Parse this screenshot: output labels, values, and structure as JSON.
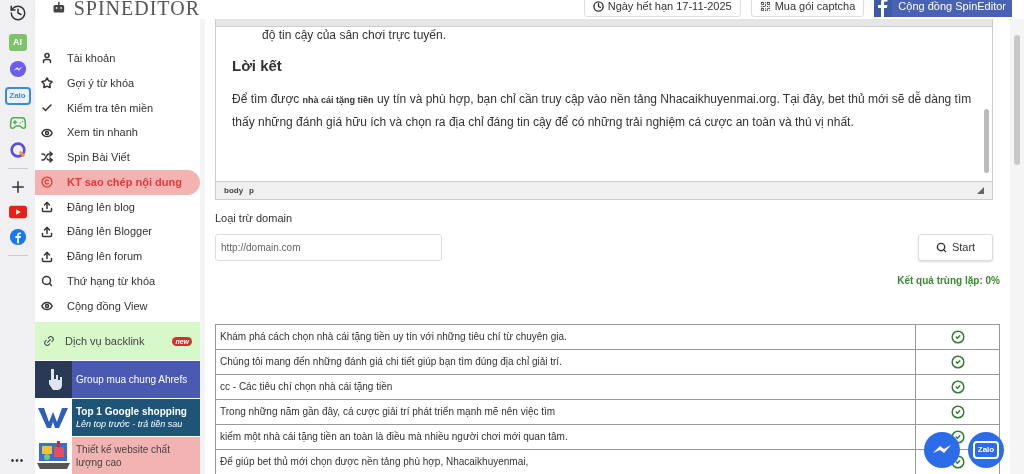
{
  "rail": {
    "ai_badge": "AI",
    "zalo_badge": "Zalo",
    "more": "•••"
  },
  "header": {
    "logo": "SPINEDITOR",
    "buttons": [
      {
        "kind": "expiry",
        "label": "Ngày hết hạn 17-11-2025"
      },
      {
        "kind": "captcha",
        "label": "Mua gói captcha"
      },
      {
        "kind": "facebook",
        "label": "Cộng đồng SpinEditor"
      }
    ]
  },
  "sidebar": {
    "items": [
      {
        "label": "Tài khoản",
        "selected": false
      },
      {
        "label": "Gợi ý từ khóa",
        "selected": false
      },
      {
        "label": "Kiểm tra tên miền",
        "selected": false
      },
      {
        "label": "Xem tin nhanh",
        "selected": false
      },
      {
        "label": "Spin Bài Viết",
        "selected": false
      },
      {
        "label": "KT sao chép nội dung",
        "selected": true
      },
      {
        "label": "Đăng lên blog",
        "selected": false
      },
      {
        "label": "Đăng lên Blogger",
        "selected": false
      },
      {
        "label": "Đăng lên forum",
        "selected": false
      },
      {
        "label": "Thứ hạng từ khóa",
        "selected": false
      },
      {
        "label": "Cộng đồng View",
        "selected": false
      }
    ],
    "backlink": {
      "label": "Dịch vụ backlink",
      "badge": "new"
    },
    "promos": [
      {
        "kind": "ahrefs",
        "title": "Group mua chung Ahrefs",
        "color": "#4a5ab3"
      },
      {
        "kind": "w",
        "title": "Top 1 Google shopping",
        "subtitle": "Lên top trước - trả tiền sau",
        "color": "#1e5478"
      },
      {
        "kind": "picture",
        "title": "Thiết kế website chất lượng cao",
        "color": "#f2b3b3"
      }
    ]
  },
  "editor": {
    "list_tail": "độ tin cậy của sân chơi trực tuyến.",
    "heading": "Lời kết",
    "paragraph": "Để tìm được **nhà cái tặng tiền** uy tín và phù hợp, bạn chỉ cần truy cập vào nền tảng Nhacaikhuyenmai.org. Tại đây, bet thủ mới sẽ dễ dàng tìm thấy những đánh giá hữu ích và chọn ra địa chỉ đáng tin cậy để có những trải nghiệm cá cược an toàn và thú vị nhất.",
    "path": [
      "body",
      "p"
    ]
  },
  "exclude": {
    "label": "Loại trừ domain",
    "placeholder": "http://domain.com"
  },
  "start_button": "Start",
  "result": "Kết quả trùng lặp: 0%",
  "table": {
    "rows": [
      {
        "text": "Khám phá cách chọn nhà cái tặng tiền uy tín với những tiêu chí từ chuyên gia.",
        "kind": "unique"
      },
      {
        "text": "Chúng tôi mang đến những đánh giá chi tiết giúp bạn tìm đúng địa chỉ giải trí.",
        "kind": "unique"
      },
      {
        "text": "cc - Các tiêu chí chọn nhà cái tặng tiền",
        "kind": "unique"
      },
      {
        "text": "Trong những năm gần đây, cá cược giải trí phát triển mạnh mẽ nên việc tìm",
        "kind": "unique"
      },
      {
        "text": "kiếm một nhà cái tặng tiền an toàn là điều mà nhiều người chơi mới quan tâm.",
        "kind": "unique"
      },
      {
        "text": "Để giúp bet thủ mới chọn được nền tảng phù hợp, Nhacaikhuyenmai,",
        "kind": "unique"
      }
    ]
  },
  "floating": {
    "zalo": "Zalo"
  }
}
